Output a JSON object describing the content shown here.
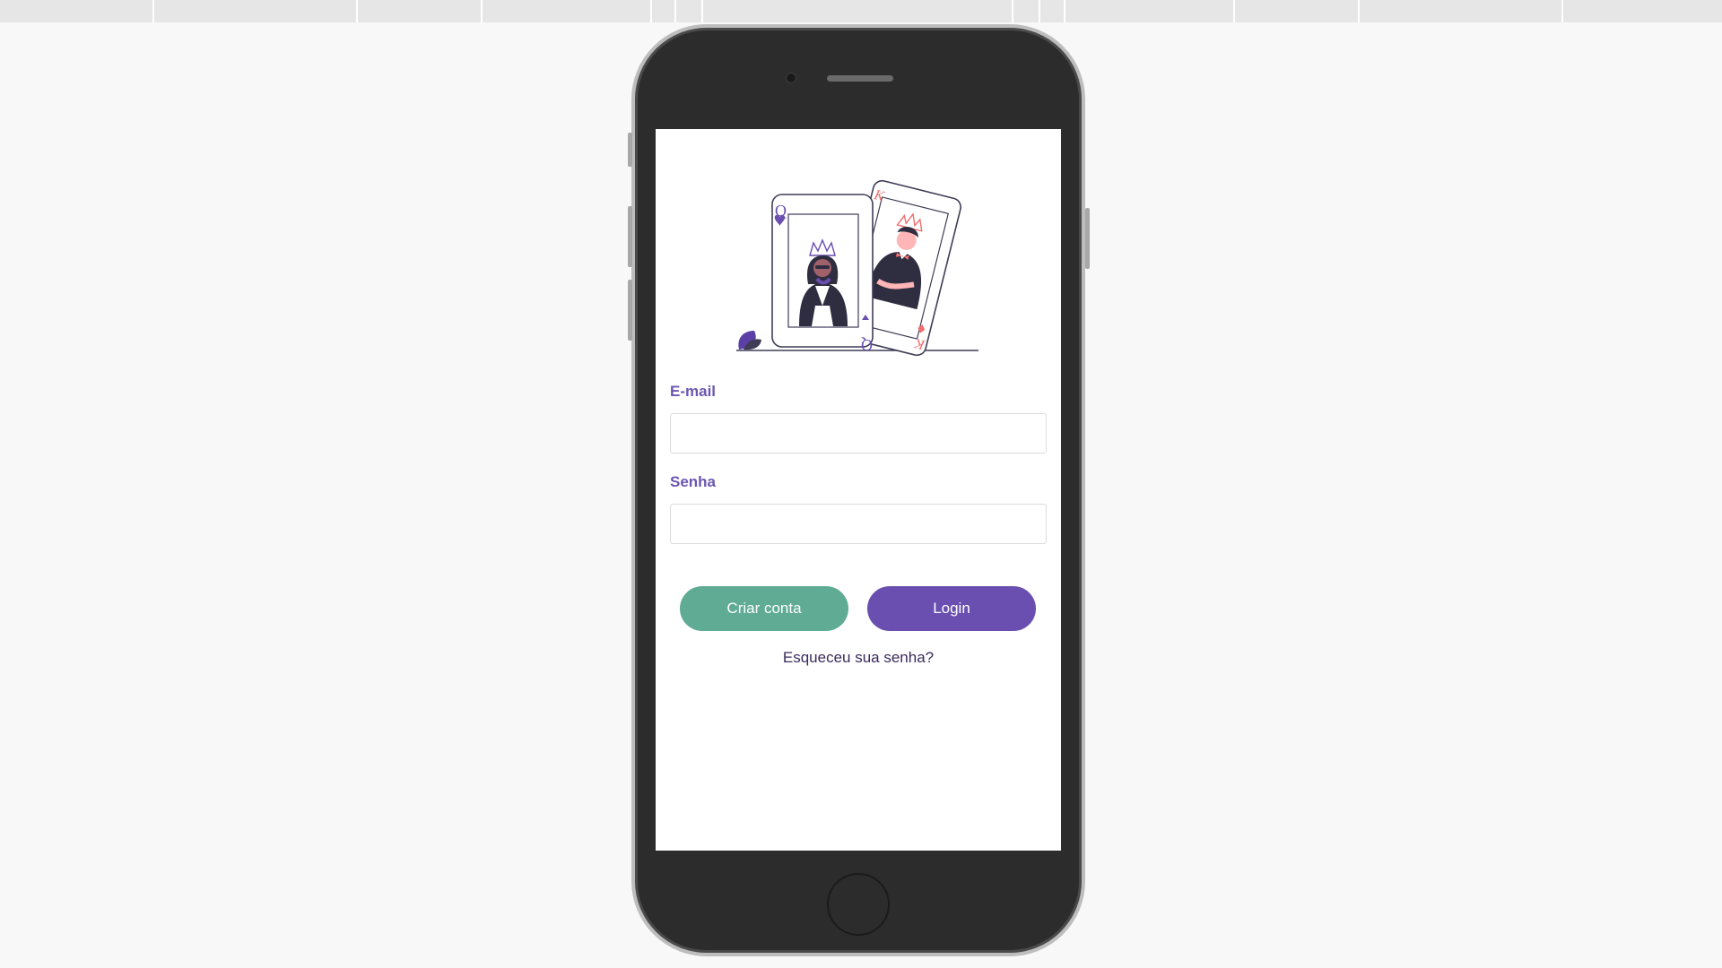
{
  "form": {
    "email_label": "E-mail",
    "email_value": "",
    "password_label": "Senha",
    "password_value": ""
  },
  "buttons": {
    "create_account_label": "Criar conta",
    "login_label": "Login"
  },
  "links": {
    "forgot_password_label": "Esqueceu sua senha?"
  },
  "colors": {
    "primary_purple": "#6a4fb0",
    "secondary_green": "#5fab94",
    "card_accent_red": "#f36e6e",
    "phone_body": "#2c2c2c"
  },
  "illustration": {
    "queen_card_letter": "Q",
    "king_card_letter": "K"
  }
}
